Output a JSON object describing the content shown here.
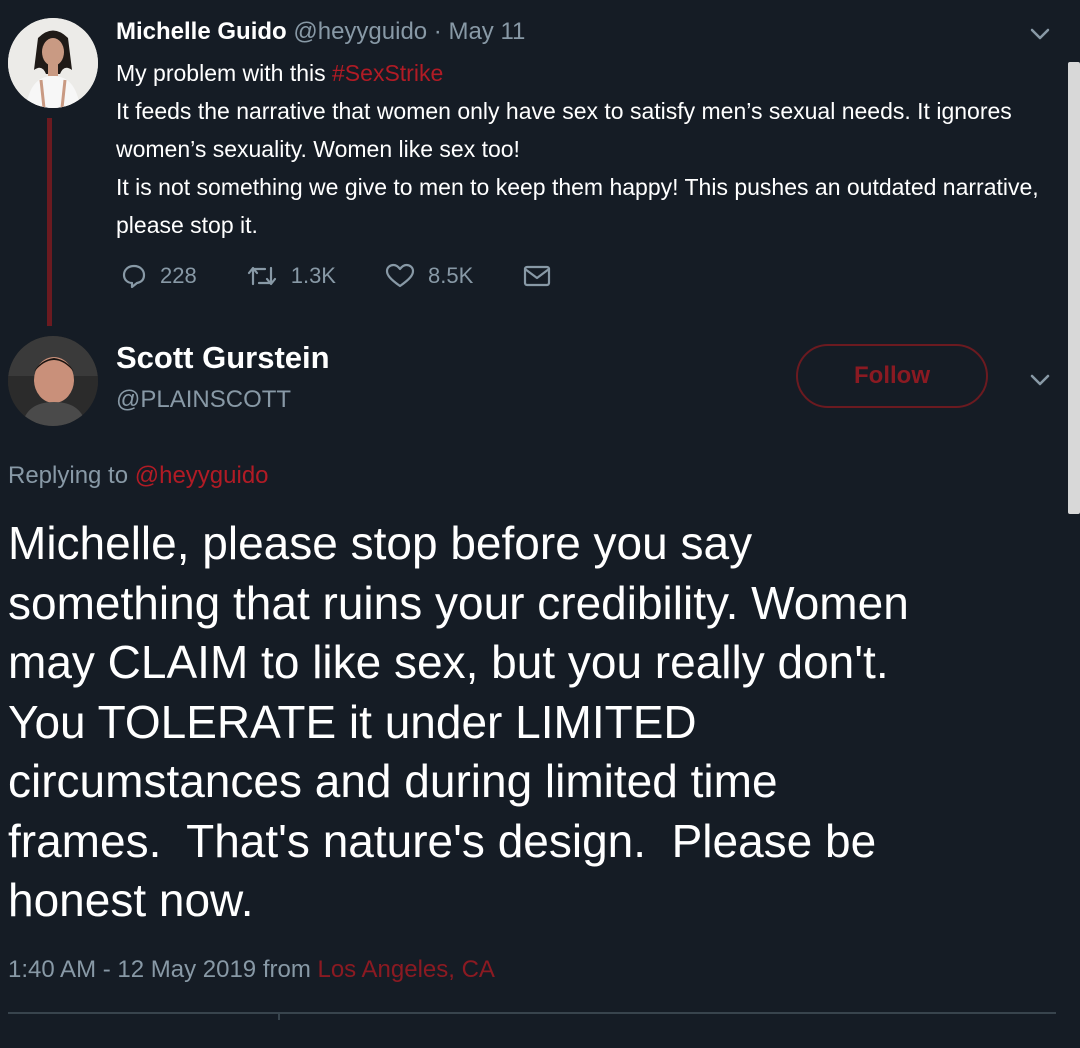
{
  "original_tweet": {
    "author_name": "Michelle Guido",
    "handle": "@heyyguido",
    "separator": " · ",
    "date": "May 11",
    "intro": "My problem with this ",
    "hashtag": "#SexStrike",
    "paragraph1": "It feeds the narrative that women only have sex to satisfy men’s sexual needs. It ignores women’s sexuality. Women like sex too!",
    "paragraph2": "It is not something we give to men to keep them happy! This pushes an outdated narrative, please stop it.",
    "reply_count": "228",
    "retweet_count": "1.3K",
    "like_count": "8.5K"
  },
  "reply_tweet": {
    "author_name": "Scott Gurstein",
    "handle": "@PLAINSCOTT",
    "follow_label": "Follow",
    "replying_to_label": "Replying to ",
    "replying_to_handle": "@heyyguido",
    "body_lines": [
      "Michelle, please stop before you say",
      "something that ruins your credibility. Women",
      "may CLAIM to like sex, but you really don't.",
      "You TOLERATE it under LIMITED",
      "circumstances and during limited time",
      "frames.  That's nature's design.  Please be",
      "honest now."
    ],
    "timestamp": "1:40 AM - 12 May 2019 from ",
    "location": "Los Angeles, CA"
  },
  "icons": [
    "reply-icon",
    "retweet-icon",
    "like-icon",
    "direct-message-icon",
    "chevron-down-icon"
  ],
  "colors": {
    "background": "#151c25",
    "accent": "#b11b25",
    "muted": "#8899a6"
  }
}
